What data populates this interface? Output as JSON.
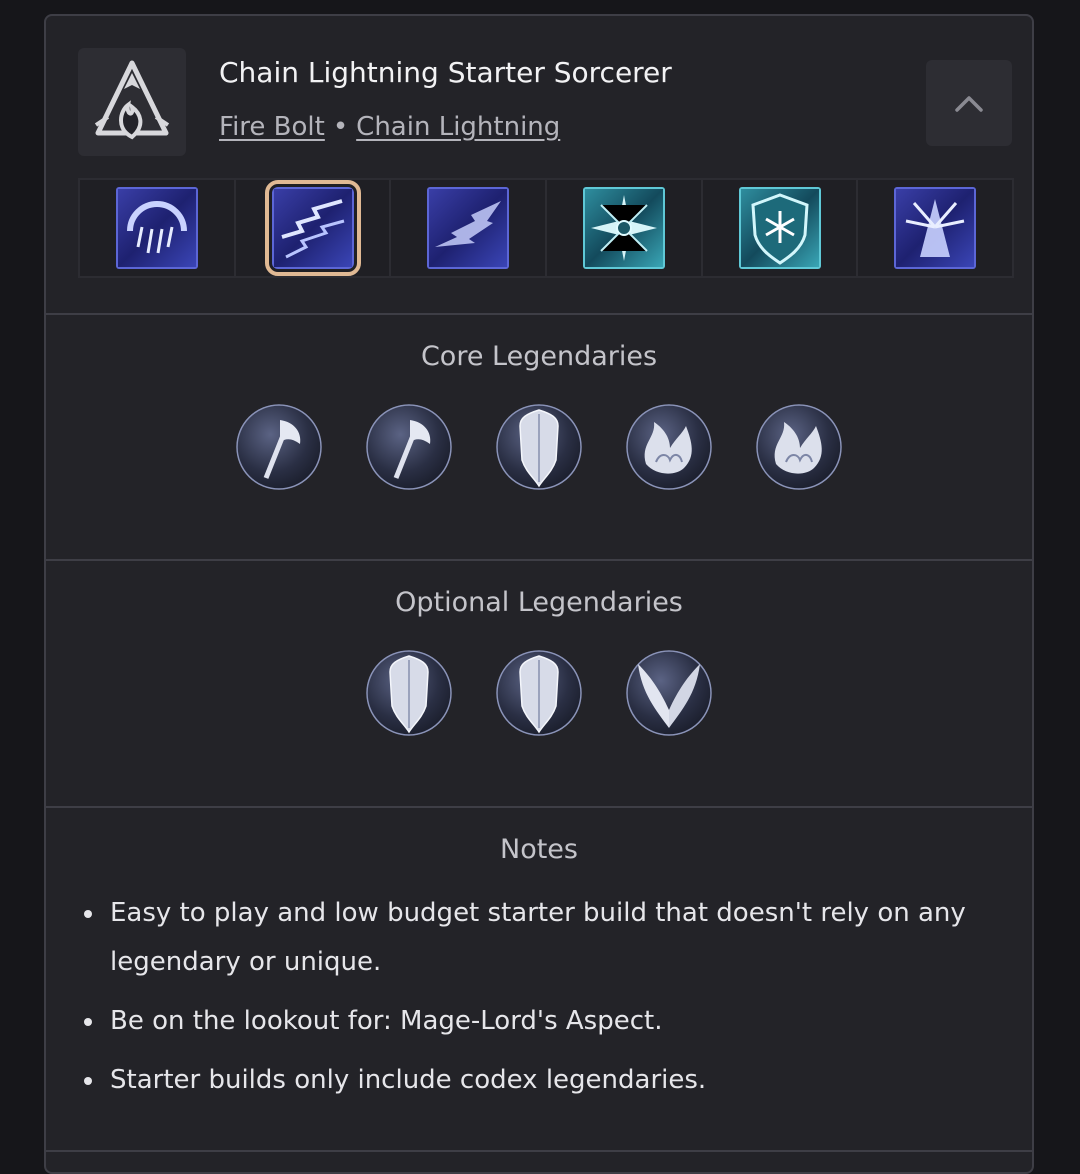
{
  "build": {
    "title": "Chain Lightning Starter Sorcerer",
    "skills_link_1": "Fire Bolt",
    "separator": "•",
    "skills_link_2": "Chain Lightning",
    "class_icon": "sorcerer-class-icon",
    "collapse_icon": "chevron-up-icon"
  },
  "skill_bar": [
    {
      "icon": "skill-lightning-arc-icon",
      "selected": false
    },
    {
      "icon": "skill-chain-lightning-icon",
      "selected": true
    },
    {
      "icon": "skill-teleport-icon",
      "selected": false
    },
    {
      "icon": "skill-frost-nova-icon",
      "selected": false
    },
    {
      "icon": "skill-ice-armor-icon",
      "selected": false
    },
    {
      "icon": "skill-unstable-currents-icon",
      "selected": false
    }
  ],
  "core_legendaries": {
    "title": "Core Legendaries",
    "items": [
      "axe-legendary-icon",
      "axe-legendary-icon",
      "shield-legendary-icon",
      "flame-legendary-icon",
      "flame-legendary-icon"
    ]
  },
  "optional_legendaries": {
    "title": "Optional Legendaries",
    "items": [
      "shield-legendary-icon",
      "shield-legendary-icon",
      "wings-legendary-icon"
    ]
  },
  "notes": {
    "title": "Notes",
    "items": [
      "Easy to play and low budget starter build that doesn't rely on any legendary or unique.",
      "Be on the lookout for: Mage-Lord's Aspect.",
      "Starter builds only include codex legendaries."
    ]
  },
  "colors": {
    "accent_selected": "#e0b994",
    "card_bg": "#232328",
    "border": "#3e3e46"
  }
}
